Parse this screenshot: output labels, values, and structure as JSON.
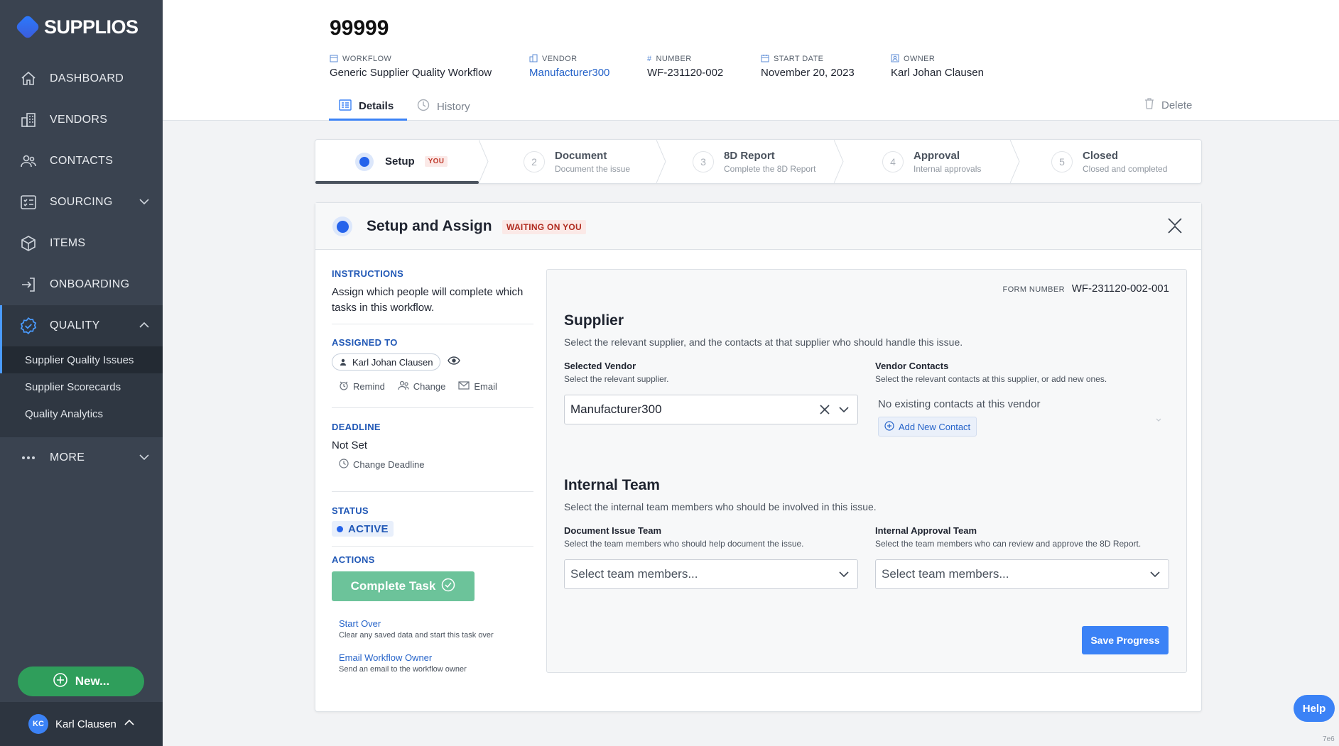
{
  "brand": {
    "name": "SUPPLIOS",
    "accent": "#3b82f6",
    "sidebar_bg": "#3a4350"
  },
  "sidebar": {
    "items": [
      {
        "label": "DASHBOARD",
        "icon": "home-icon"
      },
      {
        "label": "VENDORS",
        "icon": "building-icon"
      },
      {
        "label": "CONTACTS",
        "icon": "people-icon"
      },
      {
        "label": "SOURCING",
        "icon": "checklist-icon"
      },
      {
        "label": "ITEMS",
        "icon": "box-icon"
      },
      {
        "label": "ONBOARDING",
        "icon": "login-icon"
      },
      {
        "label": "QUALITY",
        "icon": "badge-check-icon"
      },
      {
        "label": "MORE",
        "icon": "ellipsis-icon"
      }
    ],
    "quality_sub": [
      "Supplier Quality Issues",
      "Supplier Scorecards",
      "Quality Analytics"
    ],
    "new_button": "New...",
    "user": {
      "initials": "KC",
      "name": "Karl Clausen"
    }
  },
  "header": {
    "title": "99999",
    "meta": {
      "workflow_label": "WORKFLOW",
      "workflow_value": "Generic Supplier Quality Workflow",
      "vendor_label": "VENDOR",
      "vendor_value": "Manufacturer300",
      "number_label": "NUMBER",
      "number_value": "WF-231120-002",
      "start_label": "START DATE",
      "start_value": "November 20, 2023",
      "owner_label": "OWNER",
      "owner_value": "Karl Johan Clausen"
    },
    "tabs": {
      "details": "Details",
      "history": "History"
    },
    "delete": "Delete"
  },
  "stepper": {
    "setup": {
      "title": "Setup",
      "badge": "YOU"
    },
    "steps": [
      {
        "num": "2",
        "title": "Document",
        "sub": "Document the issue"
      },
      {
        "num": "3",
        "title": "8D Report",
        "sub": "Complete the 8D Report"
      },
      {
        "num": "4",
        "title": "Approval",
        "sub": "Internal approvals"
      },
      {
        "num": "5",
        "title": "Closed",
        "sub": "Closed and completed"
      }
    ]
  },
  "card": {
    "title": "Setup and Assign",
    "badge": "WAITING ON YOU",
    "instructions_label": "INSTRUCTIONS",
    "instructions_text": "Assign which people will complete which tasks in this workflow.",
    "assigned_label": "ASSIGNED TO",
    "assignee": "Karl Johan Clausen",
    "assign_actions": {
      "remind": "Remind",
      "change": "Change",
      "email": "Email"
    },
    "deadline_label": "DEADLINE",
    "deadline_value": "Not Set",
    "change_deadline": "Change Deadline",
    "status_label": "STATUS",
    "status_value": "ACTIVE",
    "actions_label": "ACTIONS",
    "complete_task": "Complete Task",
    "start_over": "Start Over",
    "start_over_desc": "Clear any saved data and start this task over",
    "email_owner": "Email Workflow Owner",
    "email_owner_desc": "Send an email to the workflow owner"
  },
  "form": {
    "number_label": "FORM NUMBER",
    "number_value": "WF-231120-002-001",
    "supplier_title": "Supplier",
    "supplier_sub": "Select the relevant supplier, and the contacts at that supplier who should handle this issue.",
    "vendor_label": "Selected Vendor",
    "vendor_sub": "Select the relevant supplier.",
    "vendor_value": "Manufacturer300",
    "contacts_label": "Vendor Contacts",
    "contacts_sub": "Select the relevant contacts at this supplier, or add new ones.",
    "no_contacts": "No existing contacts at this vendor",
    "add_contact": "Add New Contact",
    "team_title": "Internal Team",
    "team_sub": "Select the internal team members who should be involved in this issue.",
    "doc_team_label": "Document Issue Team",
    "doc_team_sub": "Select the team members who should help document the issue.",
    "doc_team_placeholder": "Select team members...",
    "approval_team_label": "Internal Approval Team",
    "approval_team_sub": "Select the team members who can review and approve the 8D Report.",
    "approval_team_placeholder": "Select team members...",
    "save": "Save Progress"
  },
  "help": "Help",
  "corner_tag": "7e6"
}
